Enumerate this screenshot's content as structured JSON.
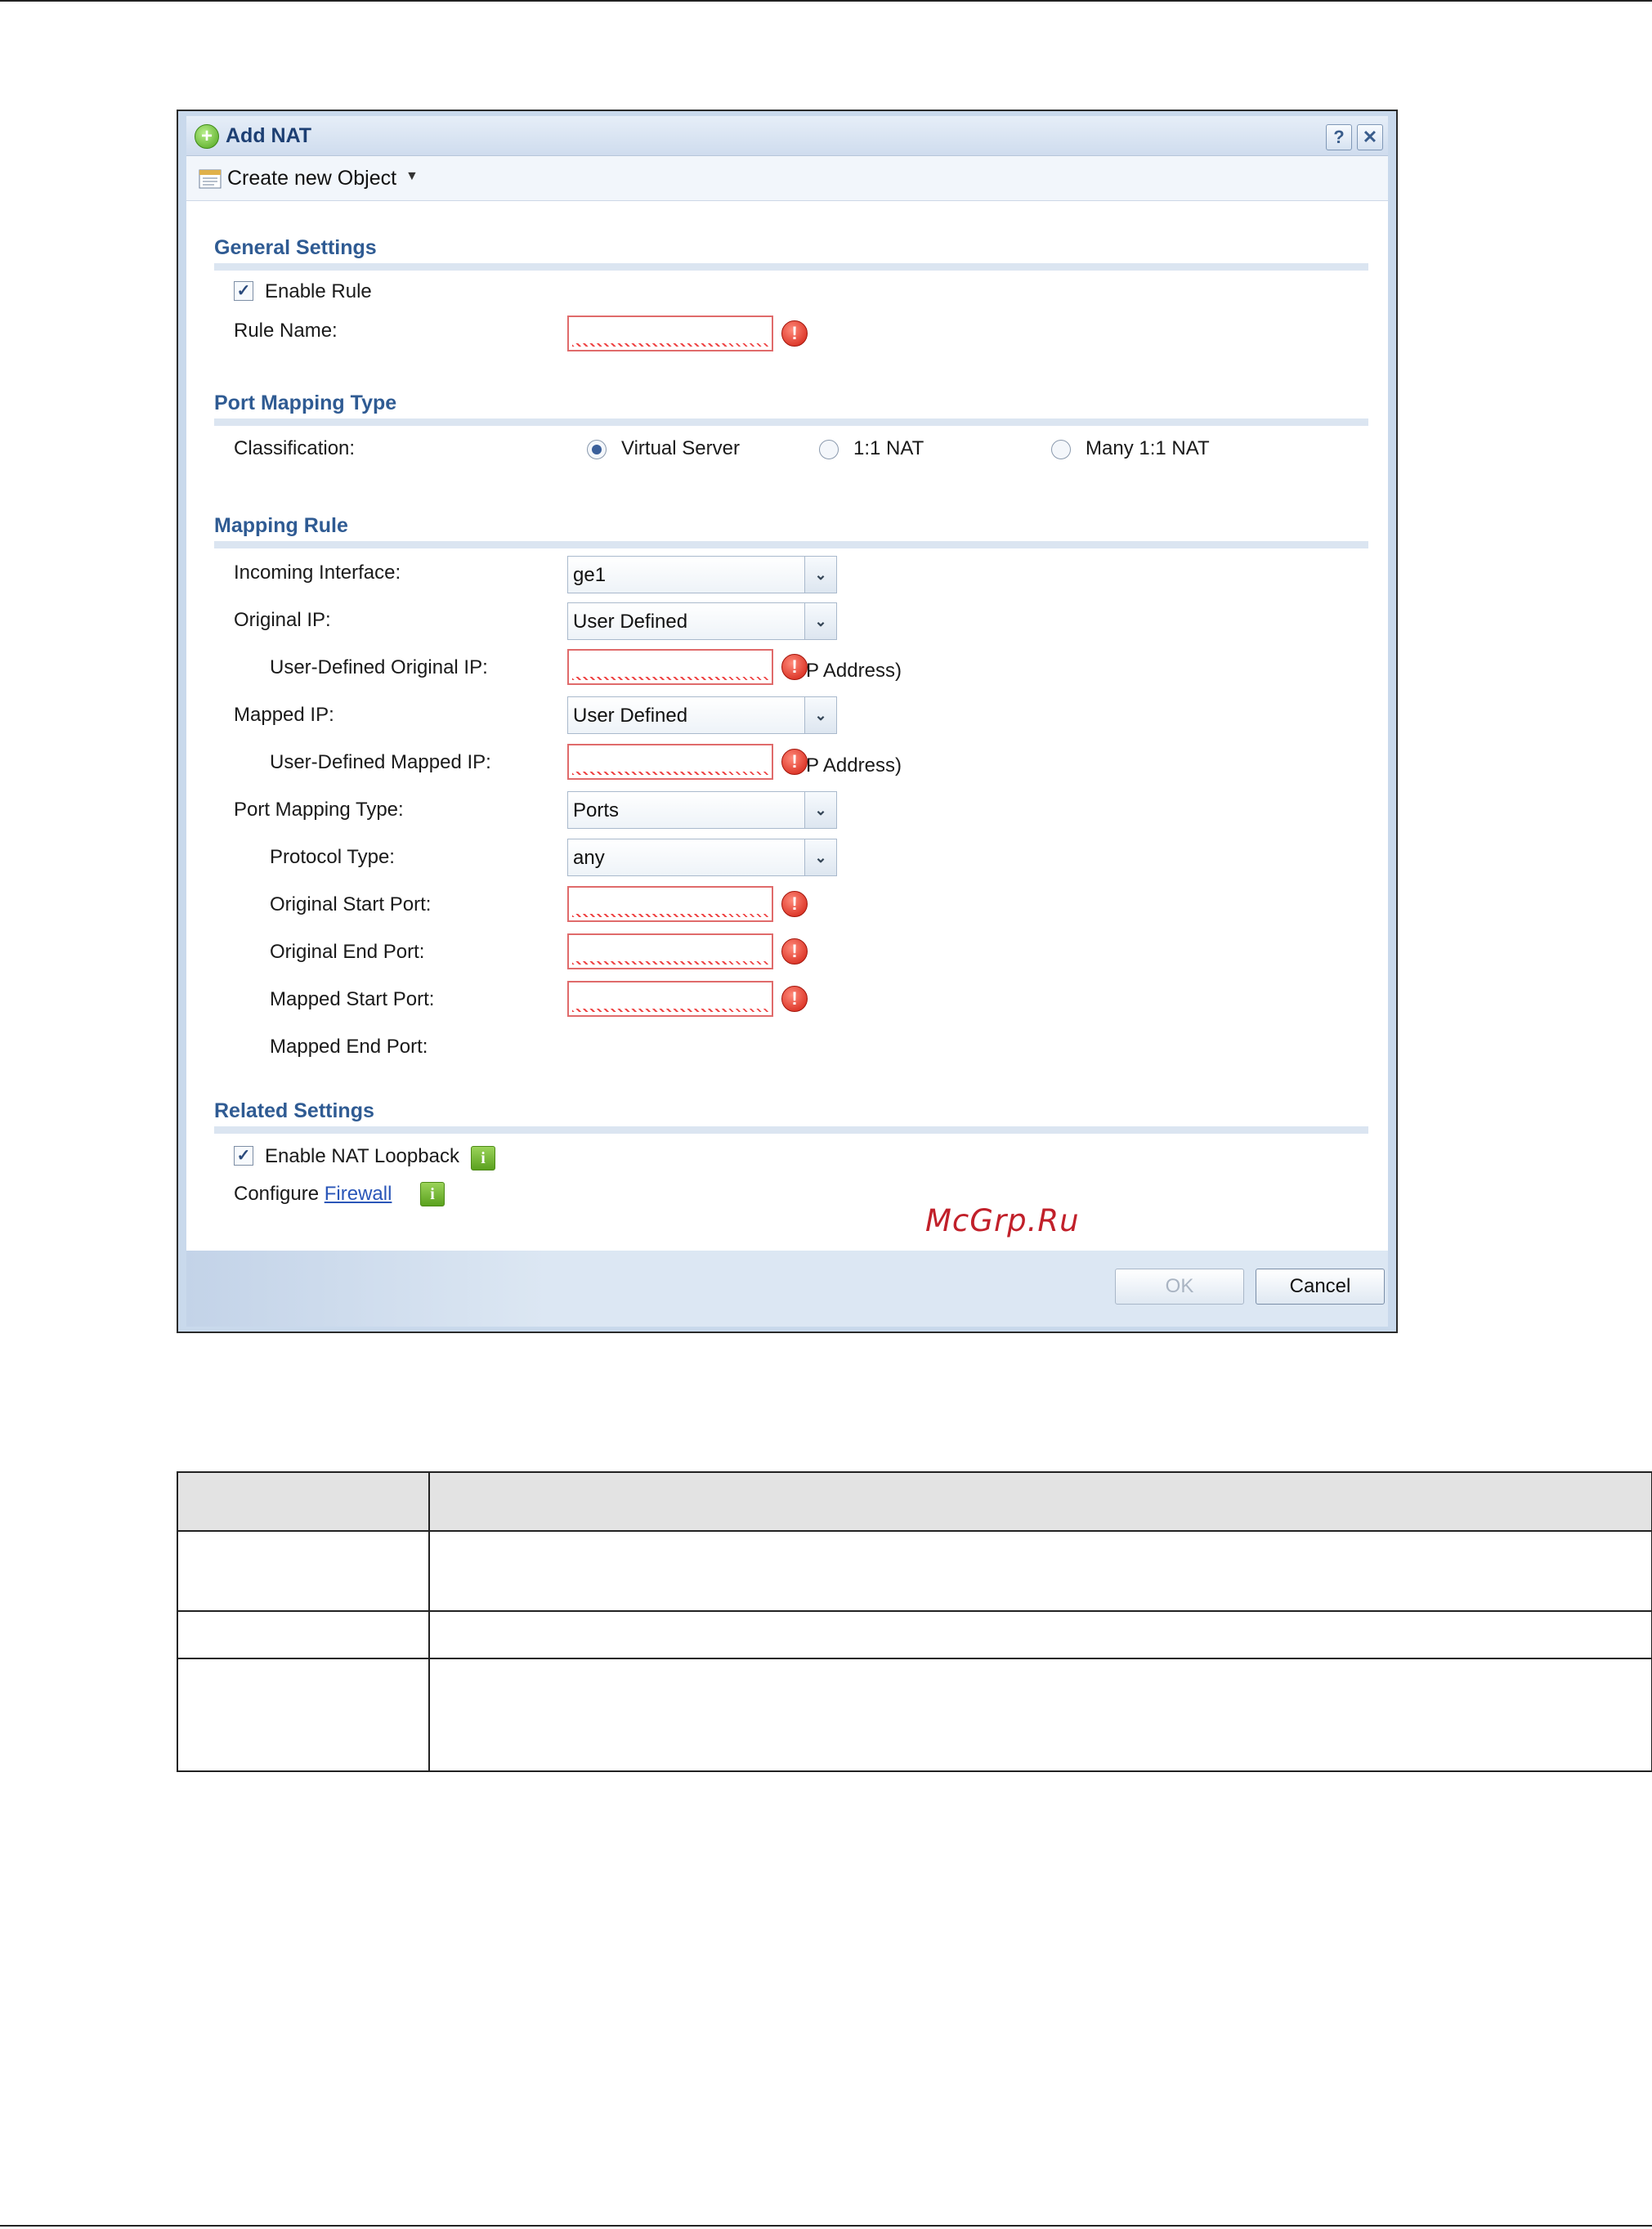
{
  "dialog": {
    "title": "Add NAT",
    "help_icon": "?",
    "close_icon": "✕",
    "toolbar": {
      "create_object_label": "Create new Object"
    }
  },
  "general": {
    "title": "General Settings",
    "enable_rule_label": "Enable Rule",
    "enable_rule_checked": true,
    "rule_name_label": "Rule Name:",
    "rule_name_value": ""
  },
  "port_mapping": {
    "title": "Port Mapping Type",
    "classification_label": "Classification:",
    "options": [
      "Virtual Server",
      "1:1 NAT",
      "Many 1:1 NAT"
    ],
    "selected": "Virtual Server"
  },
  "mapping_rule": {
    "title": "Mapping Rule",
    "incoming_interface_label": "Incoming Interface:",
    "incoming_interface_value": "ge1",
    "original_ip_label": "Original IP:",
    "original_ip_value": "User Defined",
    "user_defined_original_ip_label": "User-Defined Original IP:",
    "user_defined_original_ip_suffix": "P Address)",
    "mapped_ip_label": "Mapped IP:",
    "mapped_ip_value": "User Defined",
    "user_defined_mapped_ip_label": "User-Defined Mapped IP:",
    "user_defined_mapped_ip_suffix": "P Address)",
    "port_mapping_type_label": "Port Mapping Type:",
    "port_mapping_type_value": "Ports",
    "protocol_type_label": "Protocol Type:",
    "protocol_type_value": "any",
    "original_start_port_label": "Original Start Port:",
    "original_end_port_label": "Original End Port:",
    "mapped_start_port_label": "Mapped Start Port:",
    "mapped_end_port_label": "Mapped End Port:"
  },
  "related": {
    "title": "Related Settings",
    "enable_nat_loopback_label": "Enable NAT Loopback",
    "enable_nat_loopback_checked": true,
    "configure_label": "Configure",
    "firewall_link": "Firewall"
  },
  "buttons": {
    "ok": "OK",
    "cancel": "Cancel"
  },
  "watermark": "McGrp.Ru",
  "icons": {
    "title_icon": "add-icon",
    "error_icon": "!",
    "info_icon": "i",
    "dropdown_icon": "⌄",
    "check_glyph": "✓"
  },
  "colors": {
    "section_title": "#2f5b93",
    "error": "#d11c0f",
    "info": "#5aa11e",
    "watermark": "#c1202a"
  }
}
